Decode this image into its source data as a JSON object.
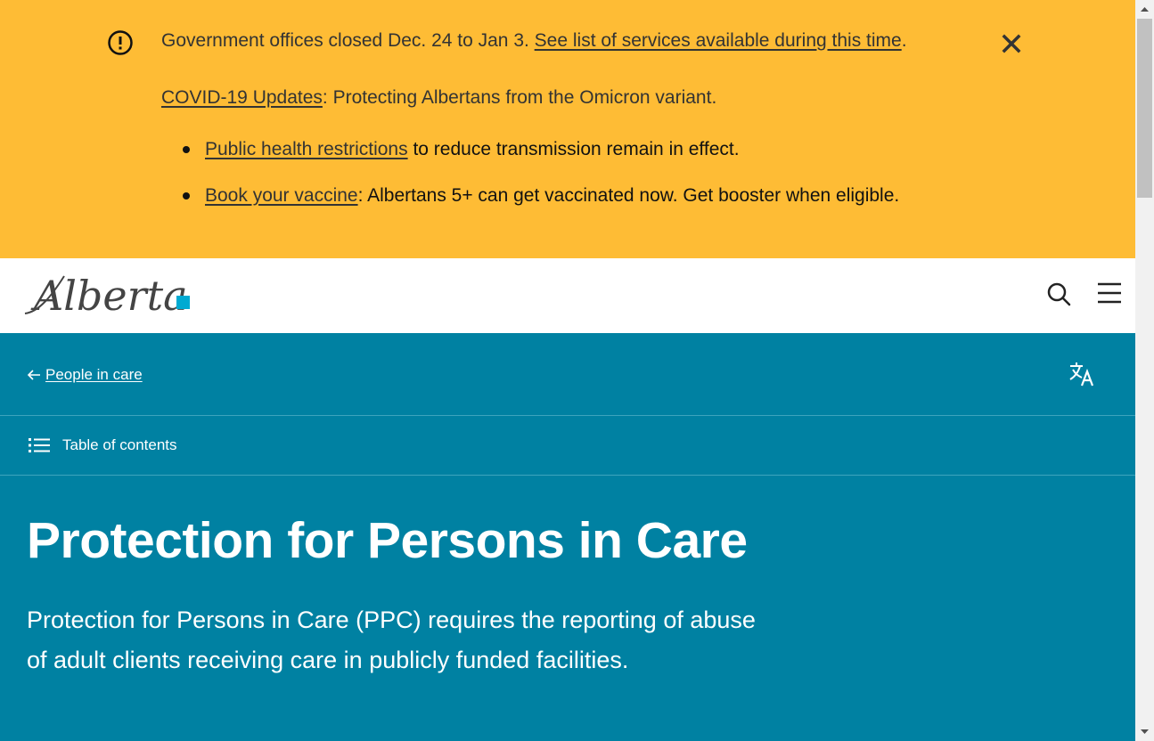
{
  "alert": {
    "line1_text": "Government offices closed Dec. 24 to Jan 3. ",
    "line1_link": "See list of services available during this time",
    "line1_end": ".",
    "line2_link": "COVID-19 Updates",
    "line2_text": ": Protecting Albertans from the Omicron variant.",
    "bullets": [
      {
        "link": "Public health restrictions",
        "text": " to reduce transmission remain in effect."
      },
      {
        "link": "Book your vaccine",
        "text": ": Albertans 5+ can get vaccinated now. Get booster when eligible."
      }
    ],
    "close_icon": "close-icon",
    "alert_icon": "exclamation-circle-icon"
  },
  "header": {
    "logo_text": "Alberta",
    "search_icon": "search-icon",
    "menu_icon": "hamburger-menu-icon"
  },
  "hero": {
    "breadcrumb_label": "People in care",
    "toc_label": "Table of contents",
    "title": "Protection for Persons in Care",
    "lede": "Protection for Persons in Care (PPC) requires the reporting of abuse of adult clients receiving care in publicly funded facilities."
  },
  "colors": {
    "alert_bg": "#febc35",
    "hero_bg": "#0081a2",
    "logo_accent": "#00aad2"
  }
}
